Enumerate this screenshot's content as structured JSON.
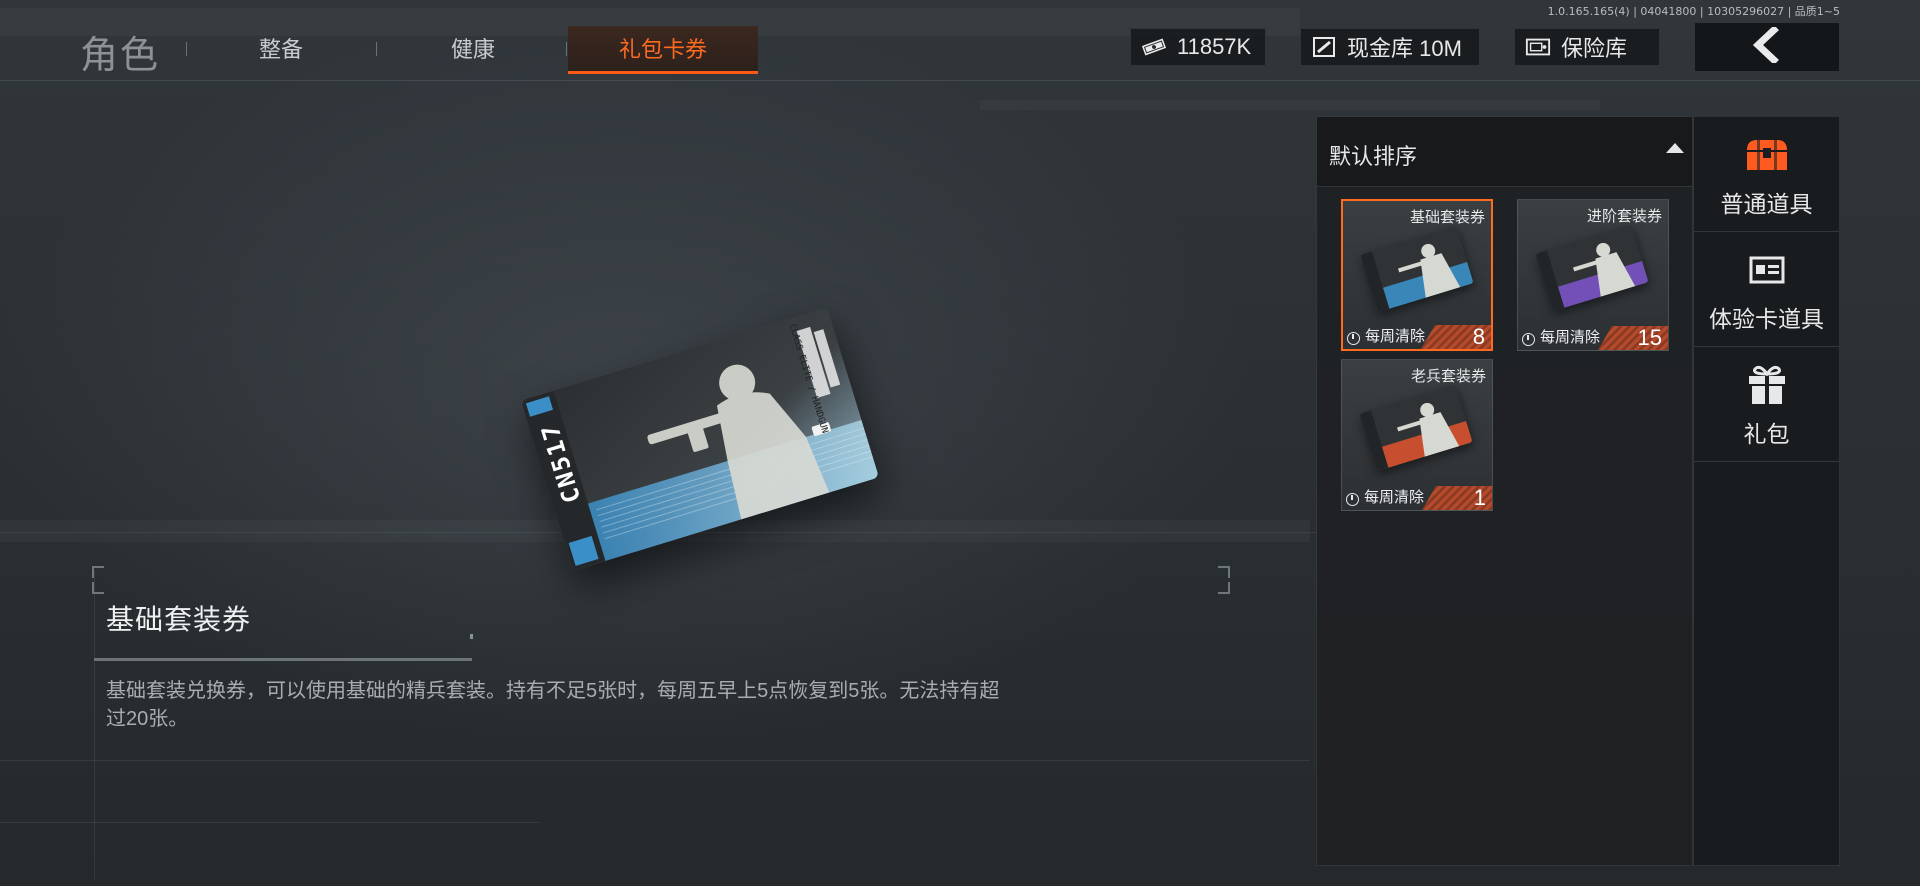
{
  "nav": {
    "title": "角色",
    "tabs": [
      {
        "label": "整备"
      },
      {
        "label": "健康"
      },
      {
        "label": "礼包卡券"
      }
    ],
    "active_tab": "礼包卡券"
  },
  "header": {
    "version": "1.0.165.165(4) | 04041800 | 10305296027 | 品质1~5",
    "cash": "11857K",
    "cash_vault": "现金库 10M",
    "safe": "保险库",
    "back_icon": "chevron-left-icon"
  },
  "card_art": {
    "logo_text": "CN517",
    "side_text": "CLASS ELITE / HANDGUN"
  },
  "detail": {
    "title": "基础套装券",
    "description": "基础套装兑换券，可以使用基础的精兵套装。持有不足5张时，每周五早上5点恢复到5张。无法持有超过20张。"
  },
  "inventory": {
    "sort_label": "默认排序",
    "items": [
      {
        "name": "基础套装券",
        "tag": "每周清除",
        "count": "8",
        "color": "#3b8fc7",
        "selected": true
      },
      {
        "name": "进阶套装券",
        "tag": "每周清除",
        "count": "15",
        "color": "#7b53c6",
        "selected": false
      },
      {
        "name": "老兵套装券",
        "tag": "每周清除",
        "count": "1",
        "color": "#d8512e",
        "selected": false
      }
    ]
  },
  "categories": [
    {
      "label": "普通道具",
      "icon": "treasure-chest-icon",
      "color": "#ff5a1f"
    },
    {
      "label": "体验卡道具",
      "icon": "id-card-icon",
      "color": "#e6e8ea"
    },
    {
      "label": "礼包",
      "icon": "gift-icon",
      "color": "#e6e8ea"
    }
  ],
  "colors": {
    "accent": "#ff6a1f",
    "basic_card": "#3b8fc7",
    "advanced_card": "#7b53c6",
    "veteran_card": "#d8512e"
  }
}
